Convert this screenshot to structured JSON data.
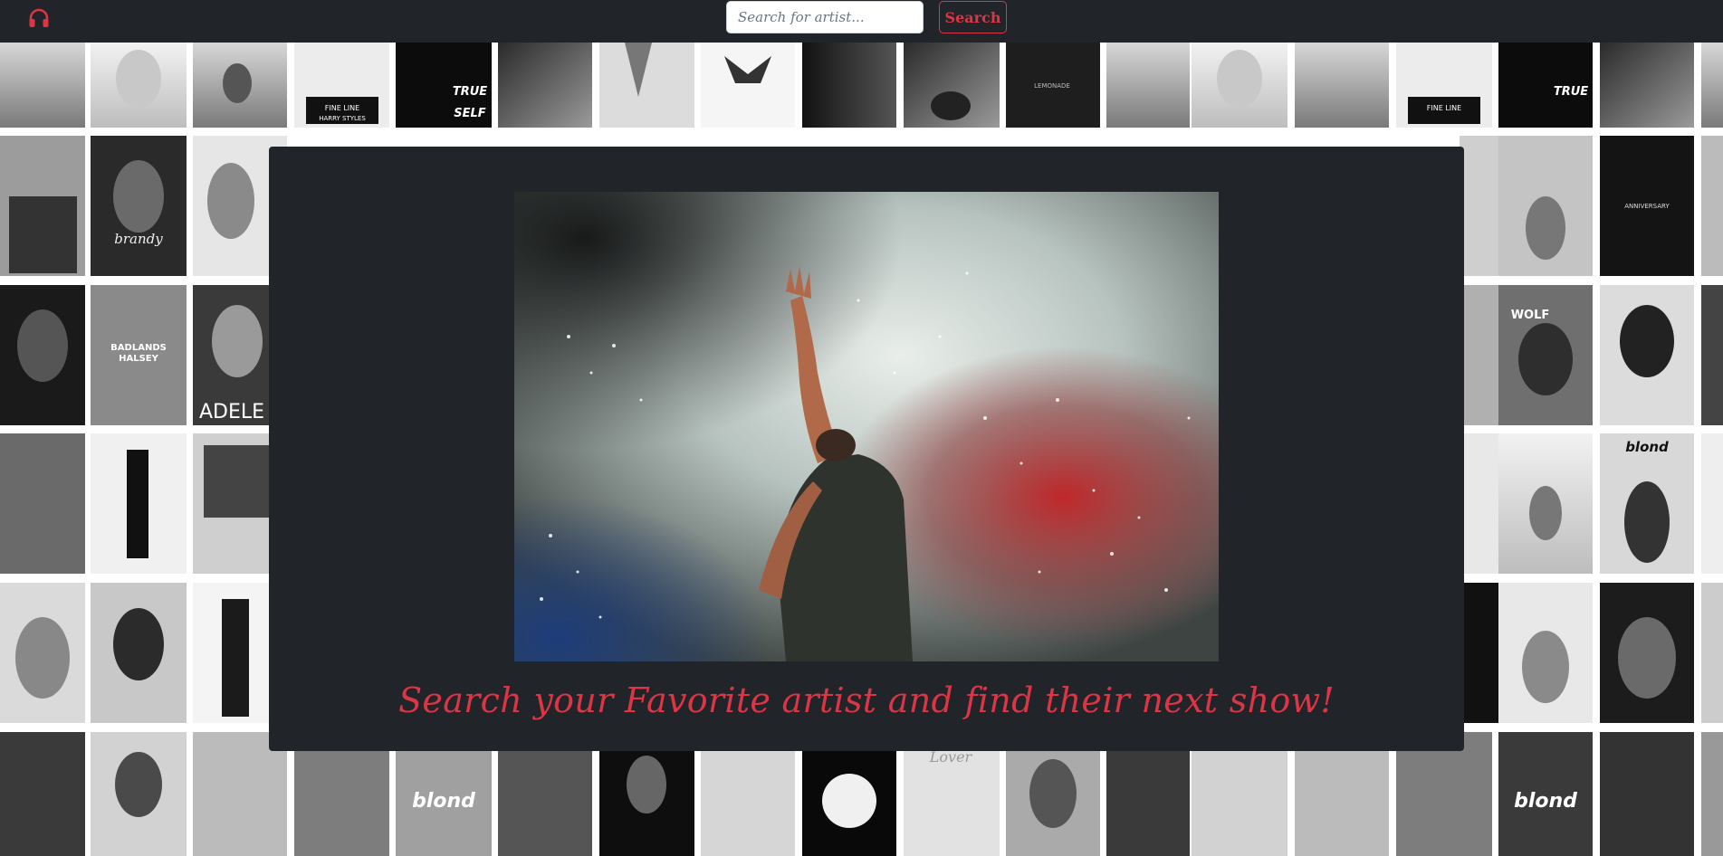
{
  "navbar": {
    "logo_icon": "headphones-icon",
    "search_placeholder": "Search for artist...",
    "search_value": "",
    "search_button_label": "Search",
    "accent_color": "#dc3545",
    "background_color": "#212529"
  },
  "background_wall": {
    "description_icon": "album-cover-collage",
    "style": "grayscale",
    "cover_text": [
      "FINE LINE",
      "HARRY STYLES",
      "TRUE TO SELF",
      "LEMONADE",
      "brandy",
      "BADLANDS",
      "HALSEY",
      "ADELE",
      "blond",
      "WOLF",
      "ANNIVERSARY",
      "blond",
      "blond",
      "Lover",
      "blond"
    ]
  },
  "hero": {
    "image_icon": "concert-singer-photo",
    "heading": "Search your Favorite artist and find their next show!"
  }
}
